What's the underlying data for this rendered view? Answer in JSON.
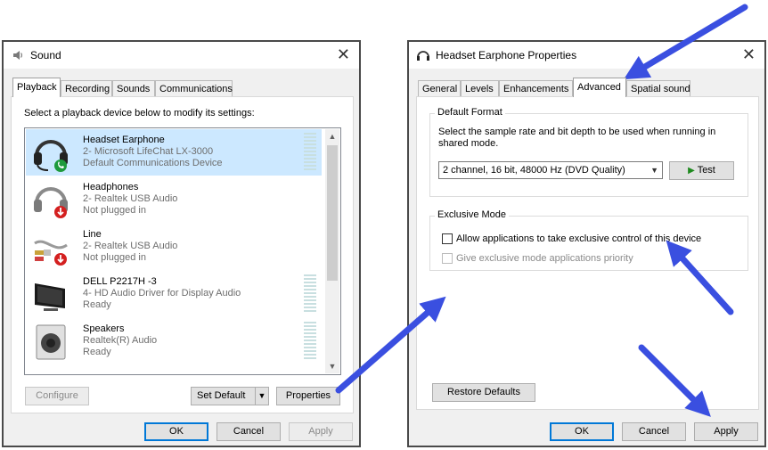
{
  "sound_window": {
    "title": "Sound",
    "tabs": [
      {
        "label": "Playback"
      },
      {
        "label": "Recording"
      },
      {
        "label": "Sounds"
      },
      {
        "label": "Communications"
      }
    ],
    "instruction": "Select a playback device below to modify its settings:",
    "devices": [
      {
        "name": "Headset Earphone",
        "line2": "2- Microsoft LifeChat LX-3000",
        "line3": "Default Communications Device",
        "selected": true,
        "icon": "headset-icon",
        "badge": "phone-badge-icon"
      },
      {
        "name": "Headphones",
        "line2": "2- Realtek USB Audio",
        "line3": "Not plugged in",
        "icon": "headphones-icon",
        "badge": "unplugged-badge-icon"
      },
      {
        "name": "Line",
        "line2": "2- Realtek USB Audio",
        "line3": "Not plugged in",
        "icon": "line-cable-icon",
        "badge": "unplugged-badge-icon"
      },
      {
        "name": "DELL P2217H -3",
        "line2": "4- HD Audio Driver for Display Audio",
        "line3": "Ready",
        "icon": "monitor-icon"
      },
      {
        "name": "Speakers",
        "line2": "Realtek(R) Audio",
        "line3": "Ready",
        "icon": "speaker-icon"
      }
    ],
    "buttons": {
      "configure": "Configure",
      "set_default": "Set Default",
      "properties": "Properties",
      "ok": "OK",
      "cancel": "Cancel",
      "apply": "Apply"
    }
  },
  "properties_window": {
    "title": "Headset Earphone Properties",
    "tabs": [
      {
        "label": "General"
      },
      {
        "label": "Levels"
      },
      {
        "label": "Enhancements"
      },
      {
        "label": "Advanced"
      },
      {
        "label": "Spatial sound"
      }
    ],
    "default_format": {
      "group_label": "Default Format",
      "description": "Select the sample rate and bit depth to be used when running in shared mode.",
      "selected_format": "2 channel, 16 bit, 48000 Hz (DVD Quality)",
      "test_label": "Test"
    },
    "exclusive_mode": {
      "group_label": "Exclusive Mode",
      "option1": "Allow applications to take exclusive control of this device",
      "option1_checked": false,
      "option2": "Give exclusive mode applications priority",
      "option2_checked": false
    },
    "buttons": {
      "restore_defaults": "Restore Defaults",
      "ok": "OK",
      "cancel": "Cancel",
      "apply": "Apply"
    }
  },
  "colors": {
    "annotation_arrow": "#3a4fe0",
    "selection": "#cce8ff",
    "test_play": "#1e8a1e"
  }
}
